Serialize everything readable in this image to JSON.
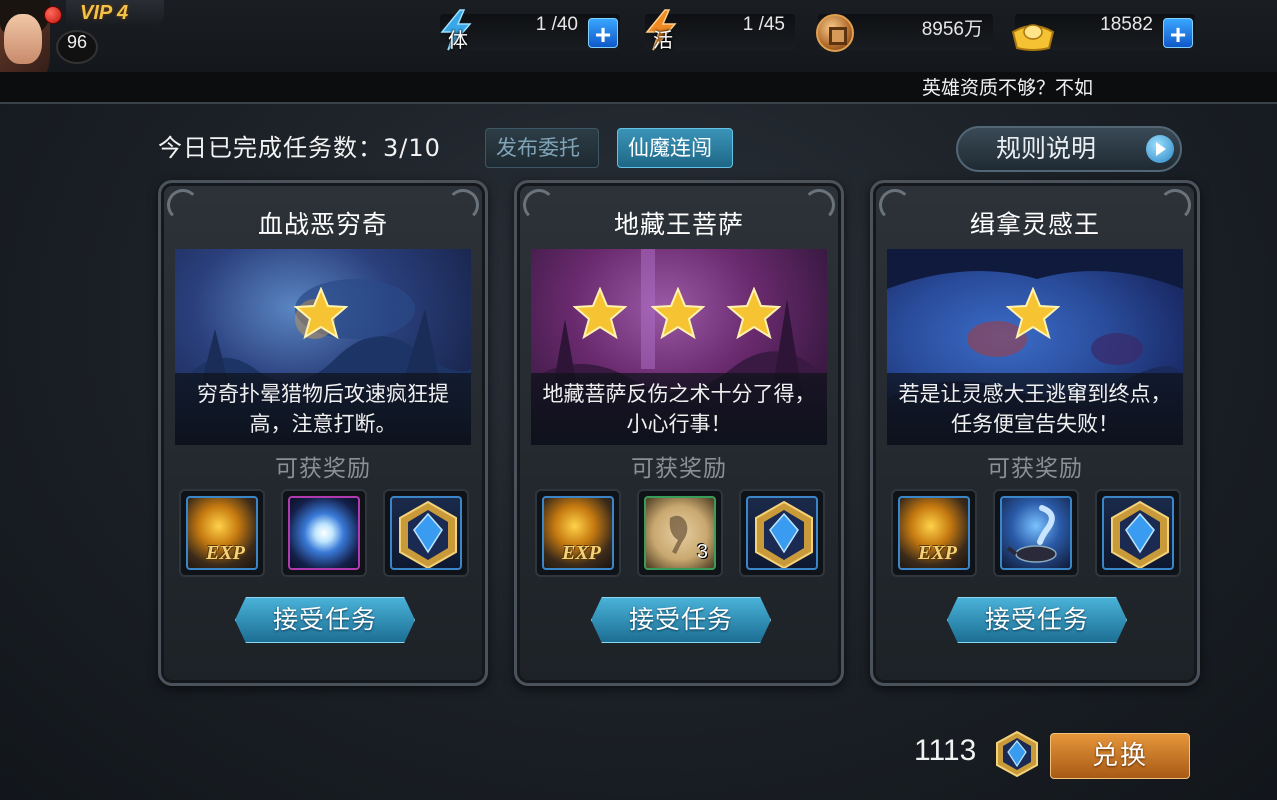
{
  "player": {
    "vip_label": "VIP 4",
    "level": "96"
  },
  "resources": {
    "stamina": {
      "char": "体",
      "value": "1 /40"
    },
    "vigor": {
      "char": "活",
      "value": "1 /45"
    },
    "copper": {
      "value": "8956万"
    },
    "gold": {
      "value": "18582"
    }
  },
  "marquee": "英雄资质不够？不如",
  "header": {
    "completed_text": "今日已完成任务数：3/10",
    "tab_publish": "发布委托",
    "tab_xianmo": "仙魔连闯",
    "rules_label": "规则说明"
  },
  "missions": [
    {
      "title": "血战恶穷奇",
      "stars": 1,
      "description": "穷奇扑晕猎物后攻速疯狂提高，注意打断。",
      "reward_label": "可获奖励",
      "rewards": [
        {
          "icon": "exp-icon",
          "text": "EXP"
        },
        {
          "icon": "spirit-orb-icon"
        },
        {
          "icon": "blue-gem-icon"
        }
      ],
      "accept_label": "接受任务"
    },
    {
      "title": "地藏王菩萨",
      "stars": 3,
      "description": "地藏菩萨反伤之术十分了得，小心行事！",
      "reward_label": "可获奖励",
      "rewards": [
        {
          "icon": "exp-icon",
          "text": "EXP"
        },
        {
          "icon": "scroll-icon",
          "count": "3"
        },
        {
          "icon": "blue-gem-icon"
        }
      ],
      "accept_label": "接受任务"
    },
    {
      "title": "缉拿灵感王",
      "stars": 1,
      "description": "若是让灵感大王逃窜到终点，任务便宣告失败！",
      "reward_label": "可获奖励",
      "rewards": [
        {
          "icon": "exp-icon",
          "text": "EXP"
        },
        {
          "icon": "magic-lamp-icon"
        },
        {
          "icon": "blue-gem-icon"
        }
      ],
      "accept_label": "接受任务"
    }
  ],
  "footer": {
    "points": "1113",
    "exchange_label": "兑换"
  },
  "colors": {
    "accent_blue": "#2f8fc0",
    "exchange_orange": "#d4822a",
    "star_gold": "#f6c432"
  }
}
